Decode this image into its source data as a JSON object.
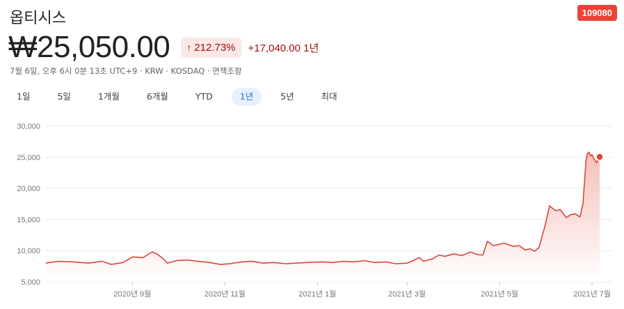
{
  "header": {
    "title": "옵티시스",
    "ticker": "109080",
    "price": "₩25,050.00",
    "change_pct": "212.73%",
    "change_abs": "+17,040.00 1년",
    "meta": "7월 6일, 오후 6시 0분 13초 UTC+9 · KRW · KOSDAQ · 면책조항"
  },
  "range_tabs": [
    {
      "label": "1일"
    },
    {
      "label": "5일"
    },
    {
      "label": "1개월"
    },
    {
      "label": "6개월"
    },
    {
      "label": "YTD"
    },
    {
      "label": "1년",
      "active": true
    },
    {
      "label": "5년"
    },
    {
      "label": "최대"
    }
  ],
  "colors": {
    "line": "#db4437",
    "fill_top": "#f5b7b1",
    "grid": "#e8eaed",
    "change_bg": "#fce8e6",
    "change_fg": "#a50e0e",
    "badge": "#ea4335",
    "active_tab_bg": "#e8f0fe",
    "active_tab_fg": "#1a73e8"
  },
  "chart_data": {
    "type": "area",
    "title": "",
    "xlabel": "",
    "ylabel": "",
    "ylim": [
      5000,
      30000
    ],
    "y_ticks": [
      5000,
      10000,
      15000,
      20000,
      25000,
      30000
    ],
    "y_tick_labels": [
      "5,000",
      "10,000",
      "15,000",
      "20,000",
      "25,000",
      "30,000"
    ],
    "x_ticks": [
      {
        "label": "2020년 9월",
        "date": "2020-09-01"
      },
      {
        "label": "2020년 11월",
        "date": "2020-11-01"
      },
      {
        "label": "2021년 1월",
        "date": "2021-01-01"
      },
      {
        "label": "2021년 3월",
        "date": "2021-03-01"
      },
      {
        "label": "2021년 5월",
        "date": "2021-05-01"
      },
      {
        "label": "2021년 7월",
        "date": "2021-07-01"
      }
    ],
    "xlim": [
      "2020-07-06",
      "2021-07-06"
    ],
    "grid": true,
    "series": [
      {
        "points": [
          [
            "2020-07-06",
            8000
          ],
          [
            "2020-07-14",
            8300
          ],
          [
            "2020-07-24",
            8200
          ],
          [
            "2020-08-03",
            8000
          ],
          [
            "2020-08-12",
            8300
          ],
          [
            "2020-08-18",
            7800
          ],
          [
            "2020-08-26",
            8100
          ],
          [
            "2020-09-01",
            9000
          ],
          [
            "2020-09-08",
            8900
          ],
          [
            "2020-09-14",
            9800
          ],
          [
            "2020-09-17",
            9500
          ],
          [
            "2020-09-21",
            8800
          ],
          [
            "2020-09-24",
            8000
          ],
          [
            "2020-09-30",
            8400
          ],
          [
            "2020-10-07",
            8500
          ],
          [
            "2020-10-14",
            8300
          ],
          [
            "2020-10-22",
            8100
          ],
          [
            "2020-10-29",
            7800
          ],
          [
            "2020-11-04",
            7900
          ],
          [
            "2020-11-12",
            8200
          ],
          [
            "2020-11-19",
            8300
          ],
          [
            "2020-11-26",
            8000
          ],
          [
            "2020-12-03",
            8100
          ],
          [
            "2020-12-11",
            7900
          ],
          [
            "2020-12-18",
            8000
          ],
          [
            "2020-12-25",
            8100
          ],
          [
            "2021-01-04",
            8200
          ],
          [
            "2021-01-11",
            8100
          ],
          [
            "2021-01-18",
            8300
          ],
          [
            "2021-01-25",
            8200
          ],
          [
            "2021-02-01",
            8400
          ],
          [
            "2021-02-08",
            8100
          ],
          [
            "2021-02-15",
            8200
          ],
          [
            "2021-02-22",
            7900
          ],
          [
            "2021-03-01",
            8000
          ],
          [
            "2021-03-05",
            8400
          ],
          [
            "2021-03-09",
            8900
          ],
          [
            "2021-03-12",
            8300
          ],
          [
            "2021-03-18",
            8700
          ],
          [
            "2021-03-22",
            9300
          ],
          [
            "2021-03-26",
            9100
          ],
          [
            "2021-04-01",
            9500
          ],
          [
            "2021-04-06",
            9200
          ],
          [
            "2021-04-12",
            9800
          ],
          [
            "2021-04-16",
            9400
          ],
          [
            "2021-04-20",
            9300
          ],
          [
            "2021-04-23",
            11500
          ],
          [
            "2021-04-27",
            10800
          ],
          [
            "2021-05-04",
            11200
          ],
          [
            "2021-05-10",
            10700
          ],
          [
            "2021-05-14",
            10800
          ],
          [
            "2021-05-18",
            10100
          ],
          [
            "2021-05-21",
            10300
          ],
          [
            "2021-05-24",
            9900
          ],
          [
            "2021-05-27",
            10500
          ],
          [
            "2021-05-31",
            14000
          ],
          [
            "2021-06-03",
            17200
          ],
          [
            "2021-06-07",
            16400
          ],
          [
            "2021-06-10",
            16600
          ],
          [
            "2021-06-14",
            15300
          ],
          [
            "2021-06-17",
            15800
          ],
          [
            "2021-06-20",
            15900
          ],
          [
            "2021-06-23",
            15400
          ],
          [
            "2021-06-25",
            17500
          ],
          [
            "2021-06-26",
            21000
          ],
          [
            "2021-06-27",
            24500
          ],
          [
            "2021-06-28",
            25600
          ],
          [
            "2021-06-29",
            25800
          ],
          [
            "2021-06-30",
            25200
          ],
          [
            "2021-07-01",
            25400
          ],
          [
            "2021-07-02",
            24800
          ],
          [
            "2021-07-03",
            24500
          ],
          [
            "2021-07-04",
            24100
          ],
          [
            "2021-07-05",
            24600
          ],
          [
            "2021-07-06",
            25050
          ]
        ]
      }
    ]
  }
}
